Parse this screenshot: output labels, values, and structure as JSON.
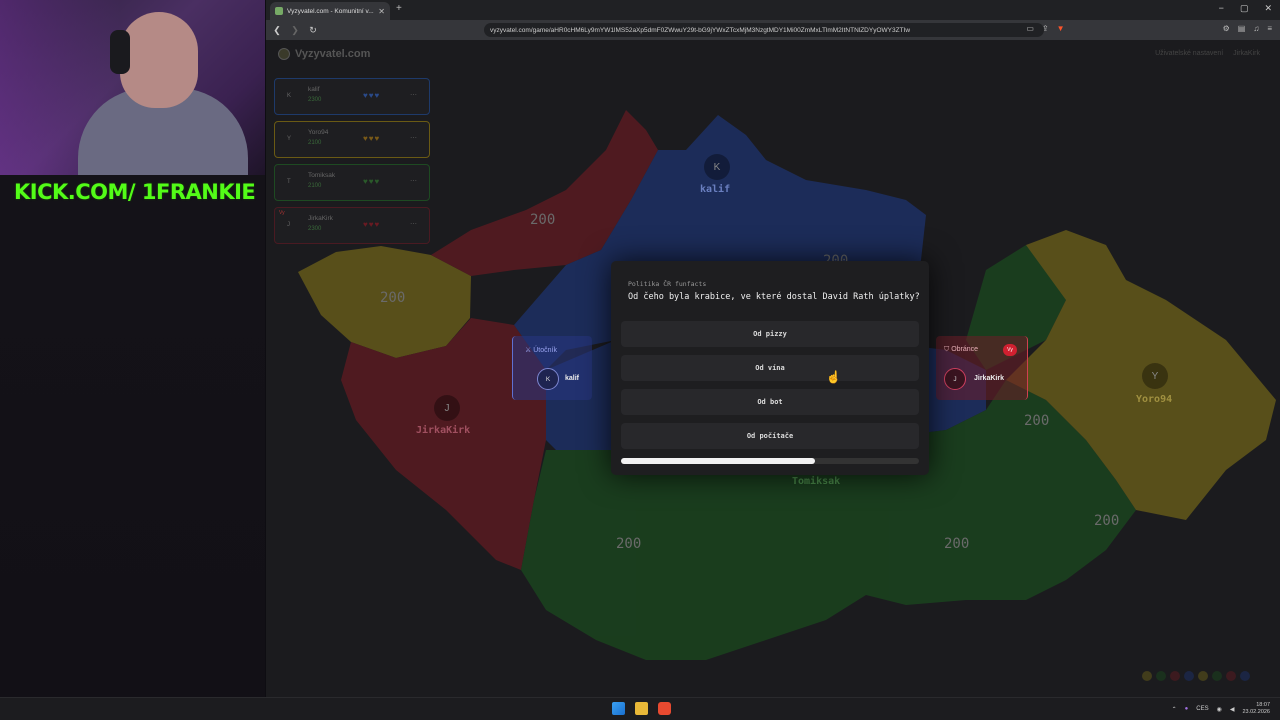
{
  "overlay": {
    "kick_text": "KICK.COM/ 1FRANKIE"
  },
  "browser": {
    "tab_title": "Vyzyvatel.com - Komunitní v...",
    "url": "vyzyvatel.com/game/aHR0cHM6Ly9mYW1lMS52aXp5dmF0ZWwuY29t-bG9jYWxZTcxMjM3NzgtMDY1Mi00ZmMxLTlmM2ItNTNlZDYyOWY3ZTIw",
    "new_tab": "+",
    "win_controls": [
      "−",
      "▢",
      "✕"
    ]
  },
  "site": {
    "logo": "Vyzyvatel.com",
    "top_right": [
      "Uživatelské nastavení",
      "JirkaKirk"
    ]
  },
  "players": [
    {
      "avatar": "K",
      "name": "kalif",
      "score": "2300",
      "hearts": "♥♥♥",
      "color": "#3050a0"
    },
    {
      "avatar": "Y",
      "name": "Yoro94",
      "score": "2100",
      "hearts": "♥♥♥",
      "color": "#8a7a20"
    },
    {
      "avatar": "T",
      "name": "Tomiksak",
      "score": "2100",
      "hearts": "♥♥♥",
      "color": "#2a6a2a"
    },
    {
      "avatar": "J",
      "name": "JirkaKirk",
      "score": "2300",
      "hearts": "♥♥♥",
      "color": "#8a2030",
      "badge": "Vy"
    }
  ],
  "map": {
    "labels": [
      "200",
      "200",
      "200",
      "200",
      "200",
      "200",
      "200",
      "200"
    ],
    "names": {
      "kalif": "kalif",
      "jirka": "JirkaKirk",
      "yoro": "Yoro94",
      "tomik": "Tomiksak"
    },
    "avatars": {
      "k": "K",
      "j": "J",
      "y": "Y"
    }
  },
  "battle": {
    "attacker_role": "Útočník",
    "attacker_avatar": "K",
    "attacker_name": "kalif",
    "defender_role": "Obránce",
    "defender_badge": "Vy",
    "defender_avatar": "J",
    "defender_name": "JirkaKirk"
  },
  "question": {
    "category": "Politika ČR funfacts",
    "text": "Od čeho byla krabice, ve které dostal David Rath úplatky?",
    "answers": [
      "Od pizzy",
      "Od vína",
      "Od bot",
      "Od počítače"
    ],
    "time_remaining_fraction": 0.65
  },
  "taskbar": {
    "lang": "CES",
    "time": "18:07",
    "date": "23.02.2026"
  }
}
